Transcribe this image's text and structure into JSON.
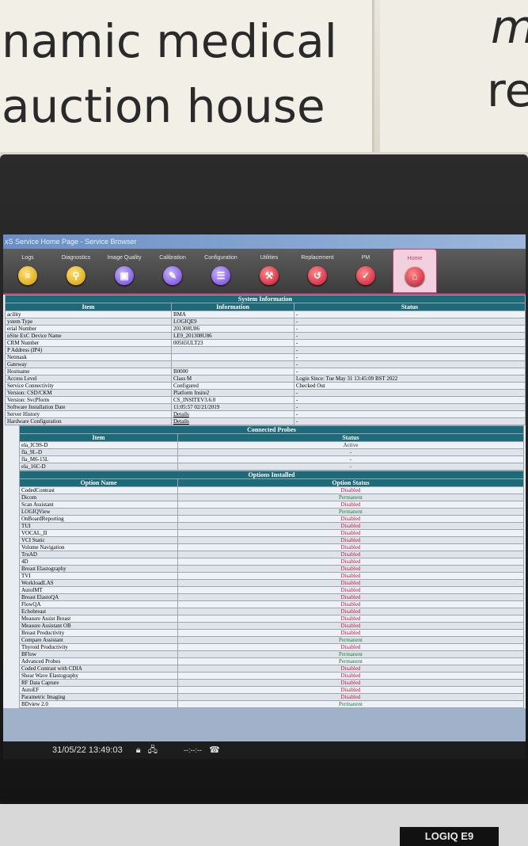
{
  "environment": {
    "sign_line1": "namic medical",
    "sign_line2": "auction house",
    "sign_right1": "m",
    "sign_right2": "re",
    "monitor_brand": "LOGIQ E9"
  },
  "window": {
    "title": "xS Service Home Page - Service Browser"
  },
  "toolbar": [
    {
      "label": "Logs",
      "icon": "logs-icon",
      "glyph": "≡",
      "color": "y"
    },
    {
      "label": "Diagnostics",
      "icon": "diagnostics-icon",
      "glyph": "⚲",
      "color": "y"
    },
    {
      "label": "Image Quality",
      "icon": "image-quality-icon",
      "glyph": "▣",
      "color": "p"
    },
    {
      "label": "Calibration",
      "icon": "calibration-icon",
      "glyph": "✎",
      "color": "p"
    },
    {
      "label": "Configuration",
      "icon": "configuration-icon",
      "glyph": "☰",
      "color": "p"
    },
    {
      "label": "Utilities",
      "icon": "utilities-icon",
      "glyph": "⚒",
      "color": "r"
    },
    {
      "label": "Replacement",
      "icon": "replacement-icon",
      "glyph": "↺",
      "color": "r"
    },
    {
      "label": "PM",
      "icon": "pm-icon",
      "glyph": "✓",
      "color": "r"
    },
    {
      "label": "Home",
      "icon": "home-icon",
      "glyph": "⌂",
      "color": "r"
    }
  ],
  "system_info": {
    "title": "System Information",
    "headers": [
      "Item",
      "Information",
      "Status"
    ],
    "rows": [
      [
        "acility",
        "BMA",
        "-"
      ],
      [
        "ystem Type",
        "LOGIQE9",
        "-"
      ],
      [
        "erial Number",
        "201308U86",
        "-"
      ],
      [
        "nSite ExC Device Name",
        "LE9_201308U86",
        "-"
      ],
      [
        "CRM Number",
        "00565ULT23",
        "-"
      ],
      [
        "P Address (IP4)",
        "",
        "-"
      ],
      [
        "Netmask",
        "",
        "-"
      ],
      [
        "Gateway",
        "",
        "-"
      ],
      [
        "Hostname",
        "B0000",
        "-"
      ],
      [
        "Access Level",
        "Class M",
        "Login Since: Tue May 31 13:45:09 BST 2022"
      ],
      [
        "Service Connectivity",
        "Configured",
        "Checked Out"
      ],
      [
        "Version: CSD/CKM",
        "Platform Insite2",
        "-"
      ],
      [
        "Version: SvcPform",
        "CS_INSITEV3.6.0",
        "-"
      ],
      [
        "Software Installation Date",
        "11:05:57 02/21/2019",
        "-"
      ],
      [
        "Server History",
        "Details",
        "-"
      ],
      [
        "Hardware Configuration",
        "Details",
        "-"
      ]
    ]
  },
  "probes": {
    "title": "Connected Probes",
    "headers": [
      "Item",
      "Status"
    ],
    "rows": [
      [
        "ela_IC9S-D",
        "Active"
      ],
      [
        "fla_9L-D",
        "-"
      ],
      [
        "fla_M6-15L",
        "-"
      ],
      [
        "ela_16C-D",
        "-"
      ]
    ]
  },
  "options": {
    "title": "Options Installed",
    "headers": [
      "Option Name",
      "Option Status"
    ],
    "rows": [
      [
        "CodedContrast",
        "Disabled"
      ],
      [
        "Dicom",
        "Permanent"
      ],
      [
        "Scan Assistant",
        "Disabled"
      ],
      [
        "LOGIQView",
        "Permanent"
      ],
      [
        "OnBoardReporting",
        "Disabled"
      ],
      [
        "TUI",
        "Disabled"
      ],
      [
        "VOCAL_II",
        "Disabled"
      ],
      [
        "VCI Static",
        "Disabled"
      ],
      [
        "Volume Navigation",
        "Disabled"
      ],
      [
        "TruAD",
        "Disabled"
      ],
      [
        "4D",
        "Disabled"
      ],
      [
        "Breast Elastography",
        "Disabled"
      ],
      [
        "TVI",
        "Disabled"
      ],
      [
        "WorkloadLAS",
        "Disabled"
      ],
      [
        "AutoIMT",
        "Disabled"
      ],
      [
        "Breast ElastoQA",
        "Disabled"
      ],
      [
        "FlowQA",
        "Disabled"
      ],
      [
        "Echobreast",
        "Disabled"
      ],
      [
        "Measure Assist Breast",
        "Disabled"
      ],
      [
        "Measure Assistant OB",
        "Disabled"
      ],
      [
        "Breast Productivity",
        "Disabled"
      ],
      [
        "Compare Assistant",
        "Permanent"
      ],
      [
        "Thyroid Productivity",
        "Disabled"
      ],
      [
        "BFlow",
        "Permanent"
      ],
      [
        "Advanced Probes",
        "Permanent"
      ],
      [
        "Coded Contrast with CDIA",
        "Disabled"
      ],
      [
        "Shear Wave Elastography",
        "Disabled"
      ],
      [
        "RF Data Capture",
        "Disabled"
      ],
      [
        "AutoEF",
        "Disabled"
      ],
      [
        "Parametric Imaging",
        "Disabled"
      ],
      [
        "BDview 2.0",
        "Permanent"
      ]
    ]
  },
  "statusbar": {
    "datetime": "31/05/22 13:49:03",
    "extra": "--:--:--"
  }
}
